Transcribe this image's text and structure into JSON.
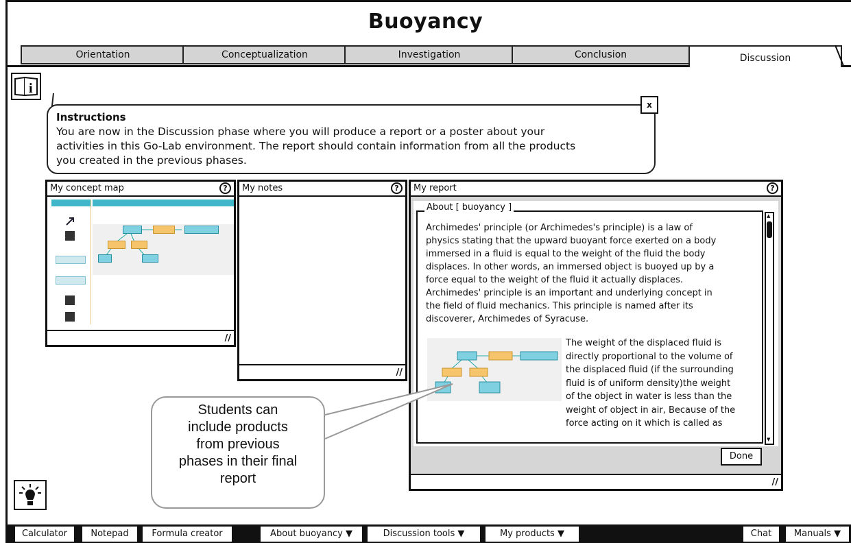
{
  "app_title": "Buoyancy",
  "tabs": [
    {
      "label": "Orientation"
    },
    {
      "label": "Conceptualization"
    },
    {
      "label": "Investigation"
    },
    {
      "label": "Conclusion"
    },
    {
      "label": "Discussion"
    }
  ],
  "instructions": {
    "title": "Instructions",
    "line1": "You are now in the Discussion phase where you will produce a report or a poster about your",
    "line2": "activities in this Go-Lab environment. The report should contain information from all the products",
    "line3": "you created in the previous phases.",
    "close_label": "x"
  },
  "panels": {
    "concept_map": {
      "title": "My concept map"
    },
    "notes": {
      "title": "My notes"
    },
    "report": {
      "title": "My report",
      "fieldset_legend": "About [ buoyancy ]",
      "paragraph1": [
        "Archimedes' principle (or Archimedes's principle) is a law of",
        "physics stating that the upward buoyant force exerted on a body",
        "immersed in a fluid is equal to the weight of the fluid the body",
        "displaces. In other words, an immersed object is buoyed up by a",
        "force equal to the weight of the fluid it actually displaces.",
        "Archimedes' principle is an important and underlying concept in",
        "the field of fluid mechanics. This principle is named after its",
        "discoverer, Archimedes of Syracuse."
      ],
      "paragraph2": [
        "The weight of the displaced fluid is",
        "directly proportional to the volume of",
        "the displaced fluid (if the surrounding",
        "fluid is of uniform density)the weight",
        "of the object in water is less than the",
        "weight of object in air, Because of the",
        "force acting on it which is called as"
      ],
      "done_label": "Done"
    }
  },
  "callout": {
    "lines": [
      "Students can",
      "include products",
      "from previous",
      "phases in their final",
      "report"
    ]
  },
  "help_symbol": "?",
  "toolbar": {
    "calculator": "Calculator",
    "notepad": "Notepad",
    "formula_creator": "Formula creator",
    "about": "About buoyancy",
    "discussion_tools": "Discussion tools",
    "my_products": "My products",
    "chat": "Chat",
    "manuals": "Manuals"
  },
  "dropdown_arrow": "▼",
  "icons": {
    "info": "info-book-icon",
    "bulb": "lightbulb-icon",
    "resize": "resize-handle-icon"
  }
}
